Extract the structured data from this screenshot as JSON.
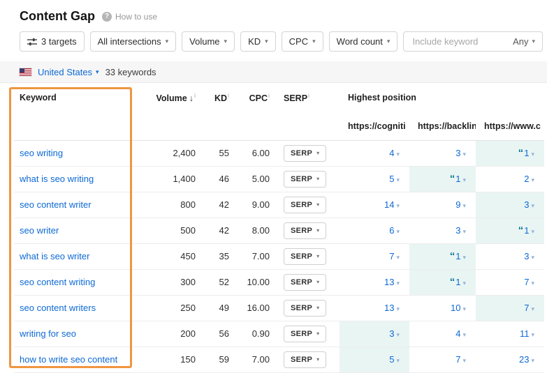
{
  "colors": {
    "link": "#0d69d5",
    "best_highlight": "#e9f5f3",
    "snippet_icon": "#0c7792",
    "annotation_border": "#f0953f"
  },
  "icons": {
    "help": "?",
    "caret_down": "▾",
    "sort_desc": "↓",
    "featured_snippet": "“",
    "info": "i"
  },
  "header": {
    "title": "Content Gap",
    "help_label": "How to use"
  },
  "toolbar": {
    "targets_label": "3 targets",
    "dropdowns": [
      {
        "label": "All intersections"
      },
      {
        "label": "Volume"
      },
      {
        "label": "KD"
      },
      {
        "label": "CPC"
      },
      {
        "label": "Word count"
      }
    ],
    "include_keyword_placeholder": "Include keyword",
    "any_label": "Any"
  },
  "location_bar": {
    "country": "United States",
    "keyword_count": "33 keywords"
  },
  "table": {
    "columns": {
      "keyword": "Keyword",
      "volume": "Volume",
      "kd": "KD",
      "cpc": "CPC",
      "serp": "SERP",
      "highest_position": "Highest position",
      "targets": [
        "https://cogniti",
        "https://backlin",
        "https://www.c"
      ]
    },
    "serp_button_label": "SERP",
    "rows": [
      {
        "keyword": "seo writing",
        "volume": "2,400",
        "kd": "55",
        "cpc": "6.00",
        "positions": [
          {
            "value": "4"
          },
          {
            "value": "3"
          },
          {
            "value": "1",
            "snippet": true,
            "best": true
          }
        ]
      },
      {
        "keyword": "what is seo writing",
        "volume": "1,400",
        "kd": "46",
        "cpc": "5.00",
        "positions": [
          {
            "value": "5"
          },
          {
            "value": "1",
            "snippet": true,
            "best": true
          },
          {
            "value": "2"
          }
        ]
      },
      {
        "keyword": "seo content writer",
        "volume": "800",
        "kd": "42",
        "cpc": "9.00",
        "positions": [
          {
            "value": "14"
          },
          {
            "value": "9"
          },
          {
            "value": "3",
            "best": true
          }
        ]
      },
      {
        "keyword": "seo writer",
        "volume": "500",
        "kd": "42",
        "cpc": "8.00",
        "positions": [
          {
            "value": "6"
          },
          {
            "value": "3"
          },
          {
            "value": "1",
            "snippet": true,
            "best": true
          }
        ]
      },
      {
        "keyword": "what is seo writer",
        "volume": "450",
        "kd": "35",
        "cpc": "7.00",
        "positions": [
          {
            "value": "7"
          },
          {
            "value": "1",
            "snippet": true,
            "best": true
          },
          {
            "value": "3"
          }
        ]
      },
      {
        "keyword": "seo content writing",
        "volume": "300",
        "kd": "52",
        "cpc": "10.00",
        "positions": [
          {
            "value": "13"
          },
          {
            "value": "1",
            "snippet": true,
            "best": true
          },
          {
            "value": "7"
          }
        ]
      },
      {
        "keyword": "seo content writers",
        "volume": "250",
        "kd": "49",
        "cpc": "16.00",
        "positions": [
          {
            "value": "13"
          },
          {
            "value": "10"
          },
          {
            "value": "7",
            "best": true
          }
        ]
      },
      {
        "keyword": "writing for seo",
        "volume": "200",
        "kd": "56",
        "cpc": "0.90",
        "positions": [
          {
            "value": "3",
            "best": true
          },
          {
            "value": "4"
          },
          {
            "value": "11"
          }
        ]
      },
      {
        "keyword": "how to write seo content",
        "volume": "150",
        "kd": "59",
        "cpc": "7.00",
        "positions": [
          {
            "value": "5",
            "best": true
          },
          {
            "value": "7"
          },
          {
            "value": "23"
          }
        ]
      }
    ]
  }
}
